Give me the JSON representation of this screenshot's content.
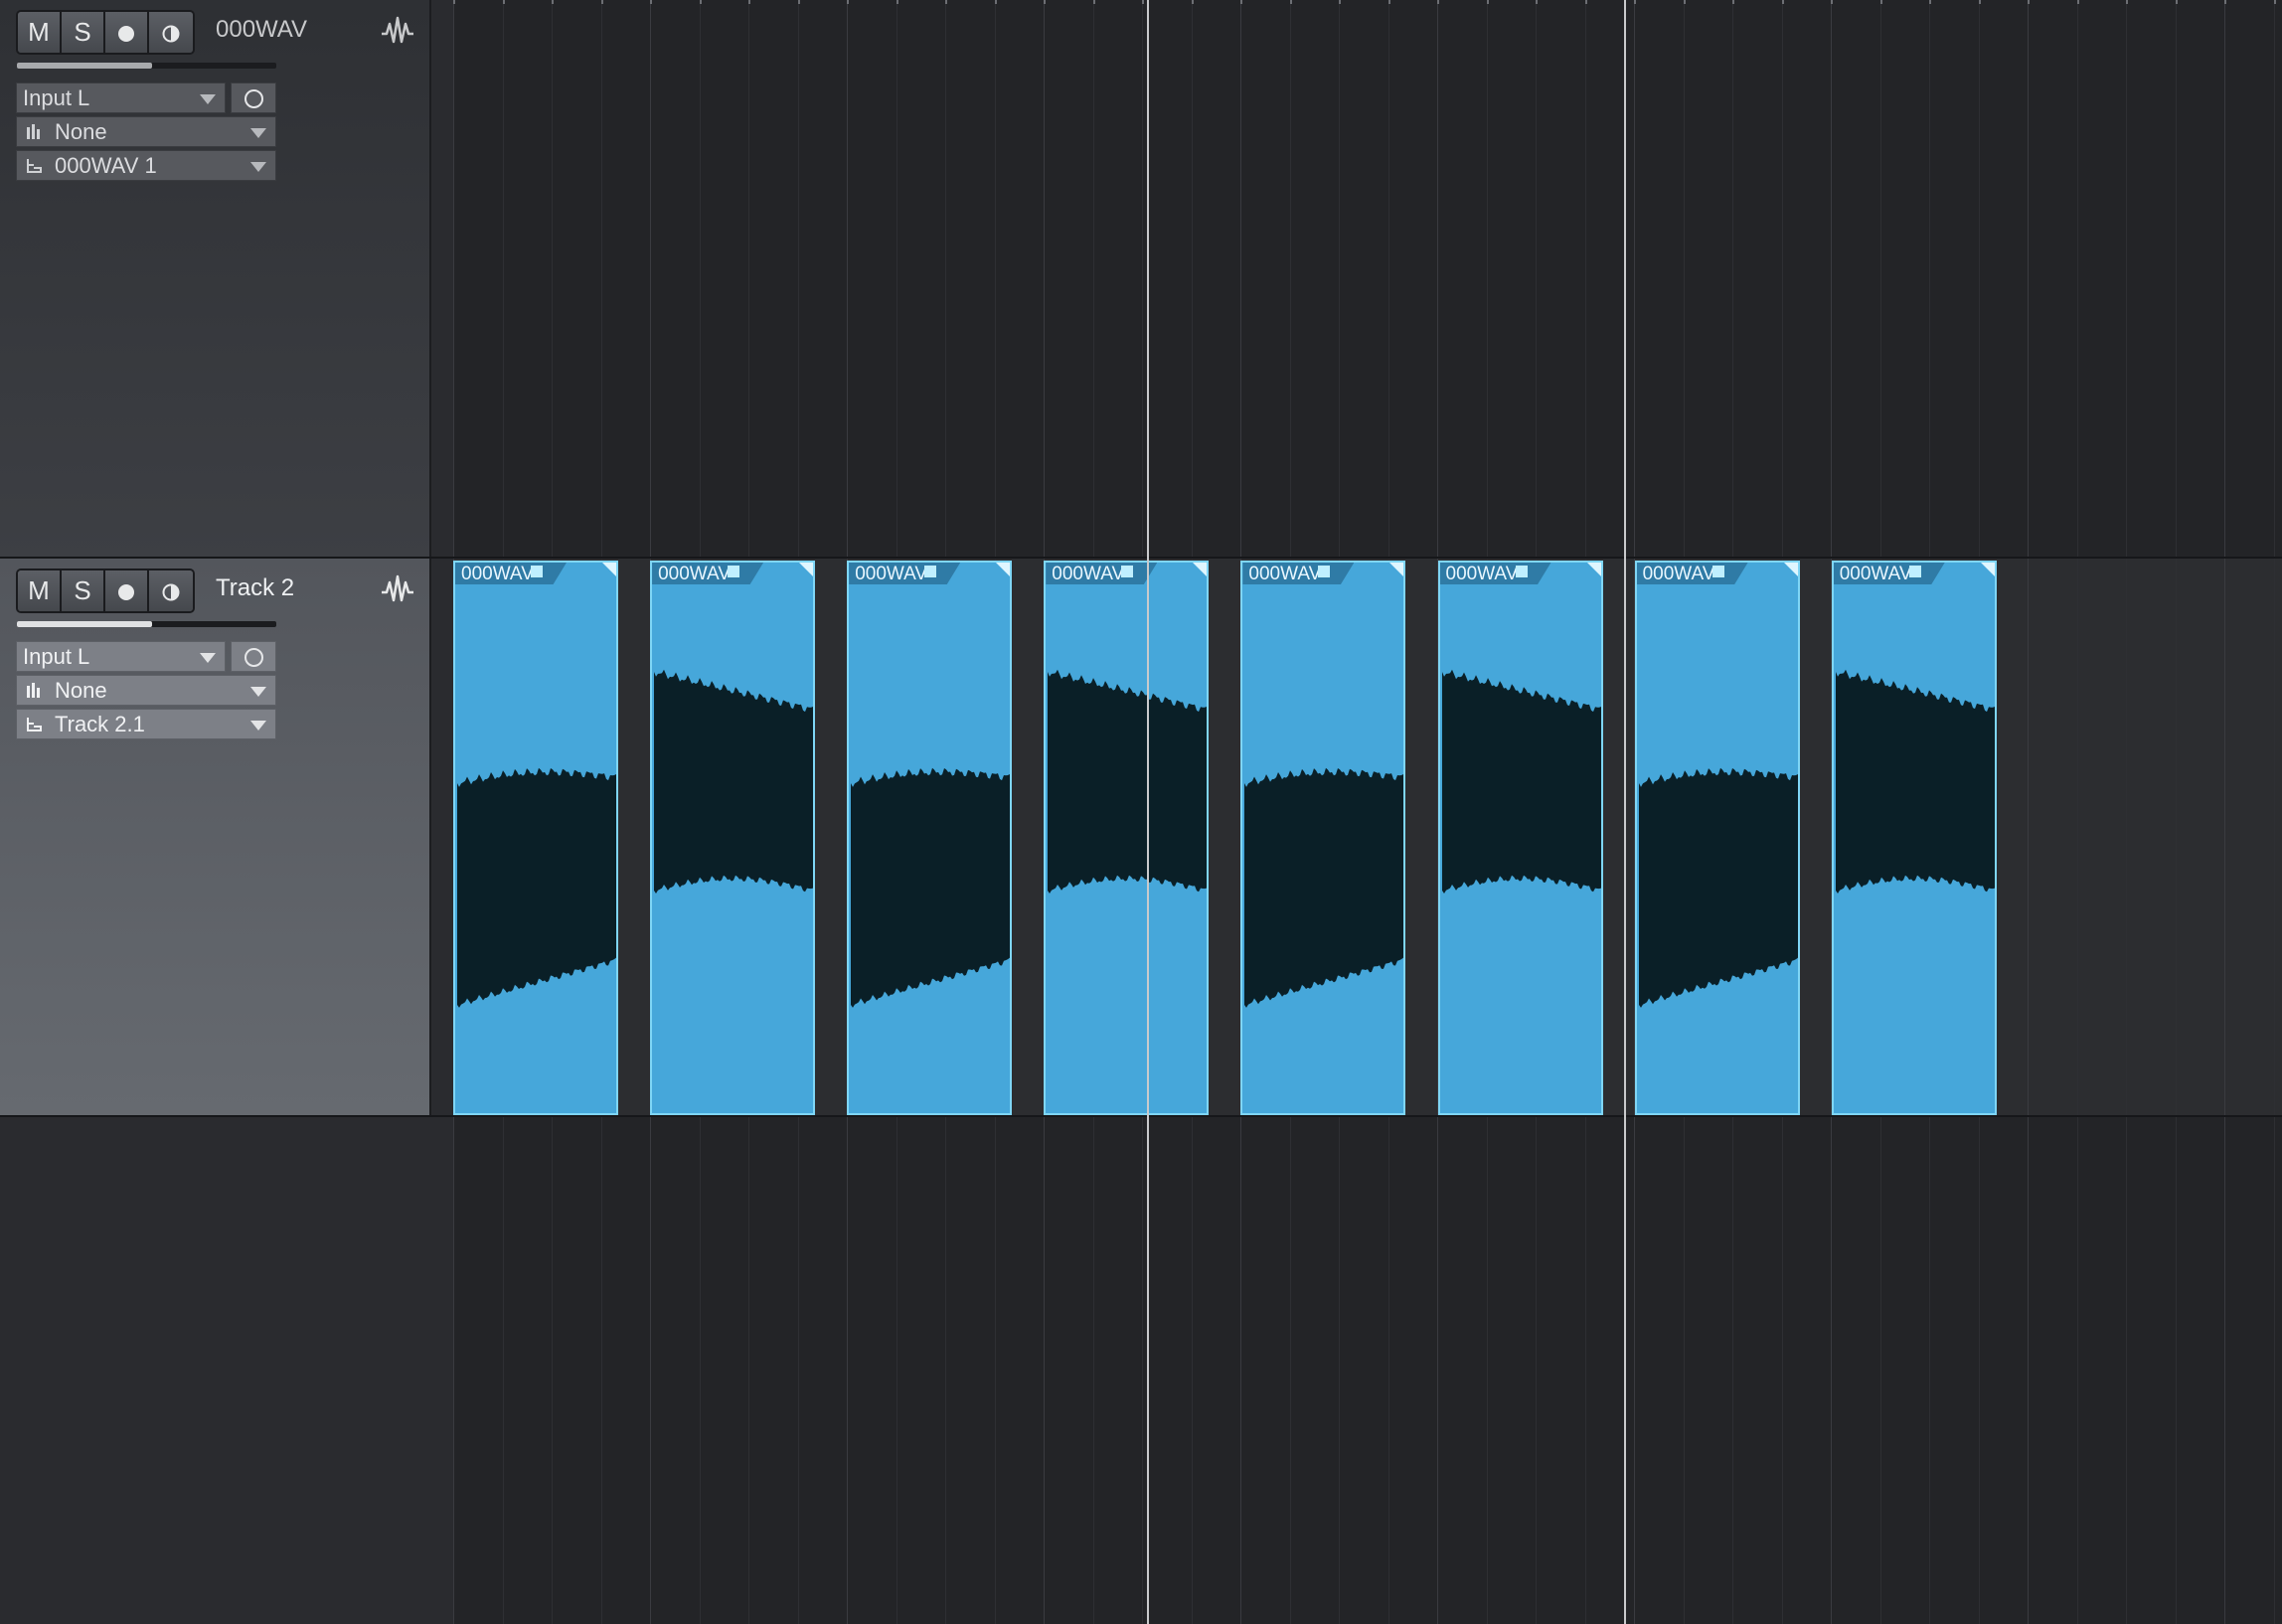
{
  "colors": {
    "clip_fill": "#46a7da",
    "clip_border": "#7fd6f6",
    "waveform": "#0a1f27",
    "background": "#232427",
    "playhead": "#c9cacc"
  },
  "tracks": [
    {
      "name": "000WAV",
      "buttons": [
        "M",
        "S",
        "record-icon",
        "monitor-icon"
      ],
      "volume_fraction": 0.52,
      "input": "Input L",
      "instrument": "None",
      "output": "000WAV 1"
    },
    {
      "name": "Track 2",
      "buttons": [
        "M",
        "S",
        "record-icon",
        "monitor-icon"
      ],
      "volume_fraction": 0.52,
      "input": "Input L",
      "instrument": "None",
      "output": "Track 2.1"
    }
  ],
  "clips": [
    {
      "label": "000WAV",
      "waveform": "A"
    },
    {
      "label": "000WAV",
      "waveform": "B"
    },
    {
      "label": "000WAV",
      "waveform": "A"
    },
    {
      "label": "000WAV",
      "waveform": "B"
    },
    {
      "label": "000WAV",
      "waveform": "A"
    },
    {
      "label": "000WAV",
      "waveform": "B"
    },
    {
      "label": "000WAV",
      "waveform": "A"
    },
    {
      "label": "000WAV",
      "waveform": "B"
    }
  ]
}
